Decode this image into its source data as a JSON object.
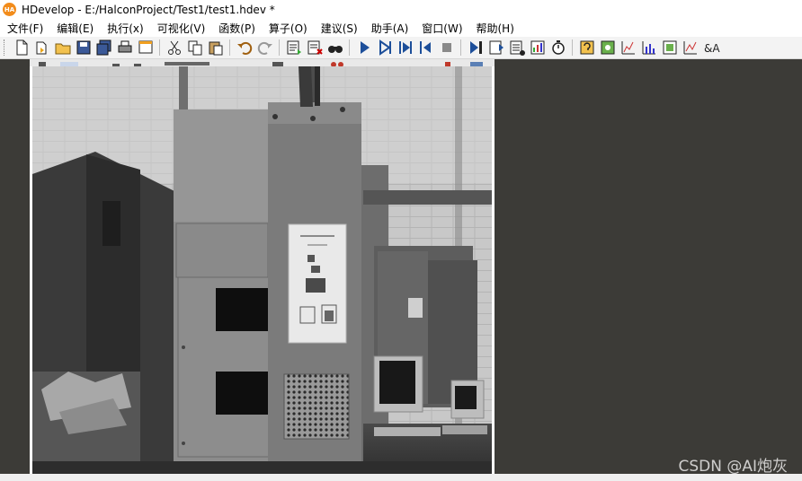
{
  "window": {
    "title": "HDevelop - E:/HalconProject/Test1/test1.hdev *",
    "logo_text": "HA"
  },
  "menubar": {
    "items": [
      {
        "label": "文件(F)"
      },
      {
        "label": "编辑(E)"
      },
      {
        "label": "执行(x)"
      },
      {
        "label": "可视化(V)"
      },
      {
        "label": "函数(P)"
      },
      {
        "label": "算子(O)"
      },
      {
        "label": "建议(S)"
      },
      {
        "label": "助手(A)"
      },
      {
        "label": "窗口(W)"
      },
      {
        "label": "帮助(H)"
      }
    ]
  },
  "toolbar": {
    "groups": [
      [
        "new-file-icon",
        "open-file-icon",
        "open-folder-icon",
        "save-icon",
        "save-all-icon",
        "print-icon",
        "program-window-icon"
      ],
      [
        "cut-icon",
        "copy-icon",
        "paste-icon"
      ],
      [
        "undo-icon",
        "redo-icon"
      ],
      [
        "insert-operator-icon",
        "delete-operator-icon",
        "find-icon"
      ],
      [
        "run-icon",
        "step-over-icon",
        "step-into-icon",
        "step-out-icon",
        "stop-icon"
      ],
      [
        "reset-program-icon",
        "reset-breakpoints-icon",
        "activate-icon",
        "profiler-icon",
        "timer-icon"
      ],
      [
        "help-icon",
        "image-acquisition-icon",
        "histogram-icon",
        "feature-histogram-icon",
        "zoom-window-icon",
        "line-profile-icon",
        "ocr-icon"
      ]
    ]
  },
  "watermark": {
    "text": "CSDN @AI炮灰"
  }
}
